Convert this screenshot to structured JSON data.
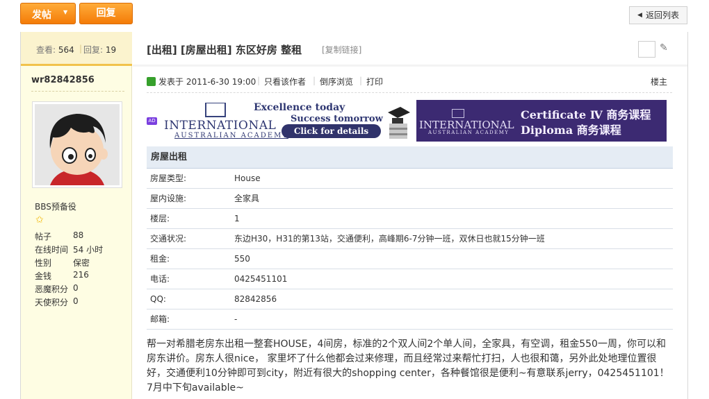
{
  "toolbar": {
    "post_label": "发帖",
    "reply_label": "回复",
    "back_label": "返回列表"
  },
  "thread_stats": {
    "views_label": "查看:",
    "views": "564",
    "replies_label": "回复:",
    "replies": "19"
  },
  "author": {
    "username": "wr82842856",
    "group": "BBS预备役",
    "stats": [
      {
        "label": "帖子",
        "value": "88"
      },
      {
        "label": "在线时间",
        "value": "54 小时"
      },
      {
        "label": "性别",
        "value": "保密"
      },
      {
        "label": "金钱",
        "value": "216"
      },
      {
        "label": "恶魔积分",
        "value": "0"
      },
      {
        "label": "天使积分",
        "value": "0"
      }
    ]
  },
  "thread": {
    "title": "[出租] [房屋出租] 东区好房 整租",
    "copy_link": "[复制链接]"
  },
  "post_meta": {
    "posted": "发表于 2011-6-30 19:00",
    "only_author": "只看该作者",
    "reverse": "倒序浏览",
    "print": "打印",
    "floor": "楼主"
  },
  "ads": {
    "ad1": {
      "tag": "AD",
      "name": "INTERNATIONAL",
      "sub": "AUSTRALIAN ACADEMY",
      "line1": "Excellence today",
      "line2": "Success tomorrow",
      "cta": "Click for details"
    },
    "ad2": {
      "name": "INTERNATIONAL",
      "sub": "AUSTRALIAN ACADEMY",
      "line1": "Certificate Ⅳ 商务课程",
      "line2": "Diploma  商务课程"
    }
  },
  "rental": {
    "heading": "房屋出租",
    "rows": [
      {
        "label": "房屋类型:",
        "value": "House"
      },
      {
        "label": "屋内设施:",
        "value": "全家具"
      },
      {
        "label": "楼层:",
        "value": "1"
      },
      {
        "label": "交通状况:",
        "value": "东边H30，H31的第13站，交通便利，高峰期6-7分钟一班，双休日也就15分钟一班"
      },
      {
        "label": "租金:",
        "value": "550"
      },
      {
        "label": "电话:",
        "value": "0425451101"
      },
      {
        "label": "QQ:",
        "value": "82842856"
      },
      {
        "label": "邮箱:",
        "value": "-"
      }
    ]
  },
  "post_body": "帮一对希腊老房东出租一整套HOUSE，4间房，标准的2个双人间2个单人间，全家具，有空调，租金550一周，你可以和房东讲价。房东人很nice， 家里坏了什么他都会过来修理，而且经常过来帮忙打扫，人也很和蔼，另外此处地理位置很好，交通便利10分钟即可到city，附近有很大的shopping center，各种餐馆很是便利~有意联系jerry，0425451101！7月中下旬available~"
}
